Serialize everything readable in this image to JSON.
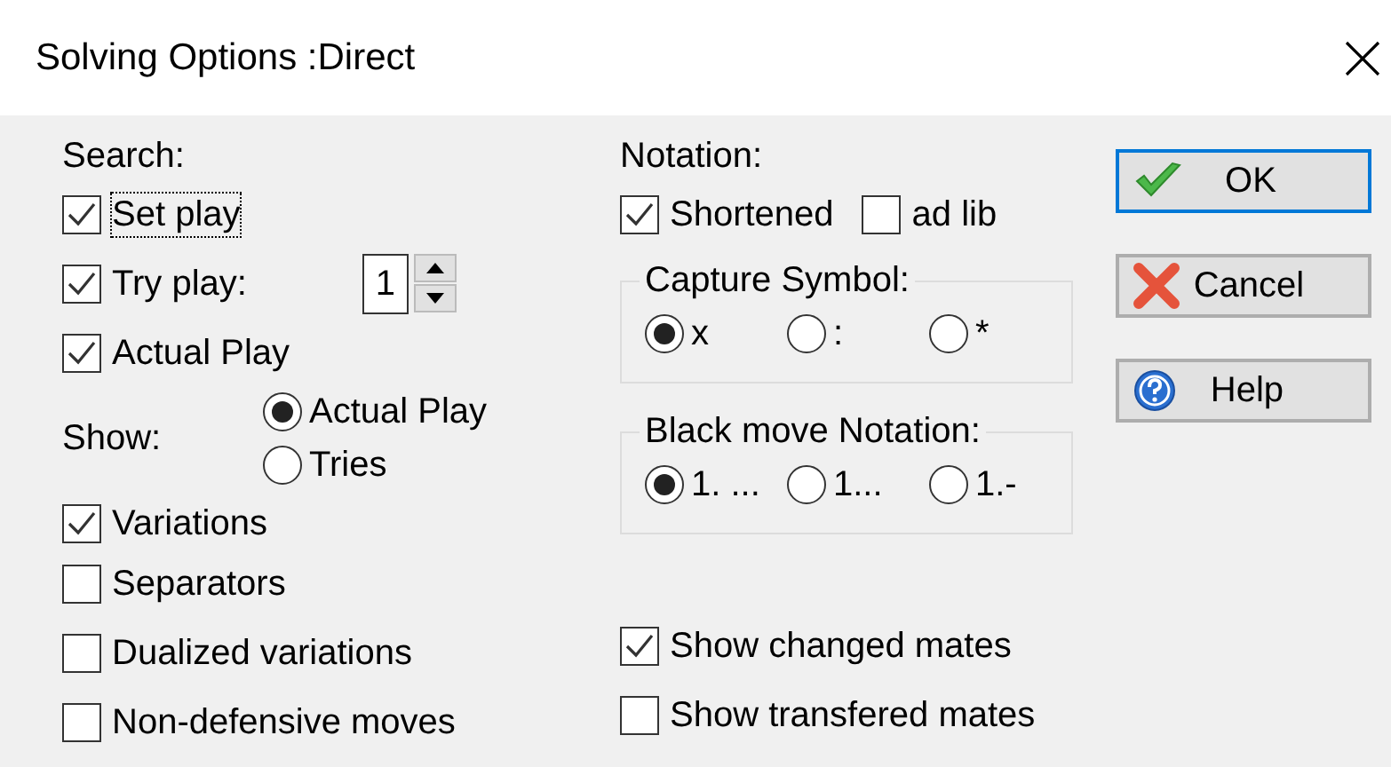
{
  "window": {
    "title": "Solving Options :Direct"
  },
  "search": {
    "label": "Search:",
    "options": [
      {
        "label": "Set play",
        "checked": true,
        "focused": true
      },
      {
        "label": "Try play:",
        "checked": true,
        "focused": false,
        "spinner": "1"
      },
      {
        "label": "Actual Play",
        "checked": true,
        "focused": false
      }
    ]
  },
  "show": {
    "label": "Show:",
    "options": [
      {
        "label": "Actual Play",
        "selected": true
      },
      {
        "label": "Tries",
        "selected": false
      }
    ]
  },
  "display_options": [
    {
      "label": "Variations",
      "checked": true
    },
    {
      "label": "Separators",
      "checked": false
    },
    {
      "label": "Dualized variations",
      "checked": false
    },
    {
      "label": "Non-defensive moves",
      "checked": false
    }
  ],
  "notation": {
    "label": "Notation:",
    "options": [
      {
        "label": "Shortened",
        "checked": true
      },
      {
        "label": "ad lib",
        "checked": false
      }
    ]
  },
  "capture_symbol": {
    "label": "Capture Symbol:",
    "options": [
      {
        "label": "x",
        "selected": true
      },
      {
        "label": ":",
        "selected": false
      },
      {
        "label": "*",
        "selected": false
      }
    ]
  },
  "black_move_notation": {
    "label": "Black move Notation:",
    "options": [
      {
        "label": "1. ...",
        "selected": true
      },
      {
        "label": "1...",
        "selected": false
      },
      {
        "label": "1.-",
        "selected": false
      }
    ]
  },
  "mates": [
    {
      "label": "Show changed mates",
      "checked": true
    },
    {
      "label": "Show transfered mates",
      "checked": false
    }
  ],
  "buttons": [
    {
      "label": "OK",
      "kind": "ok",
      "default": true
    },
    {
      "label": "Cancel",
      "kind": "cancel",
      "default": false
    },
    {
      "label": "Help",
      "kind": "help",
      "default": false
    }
  ]
}
